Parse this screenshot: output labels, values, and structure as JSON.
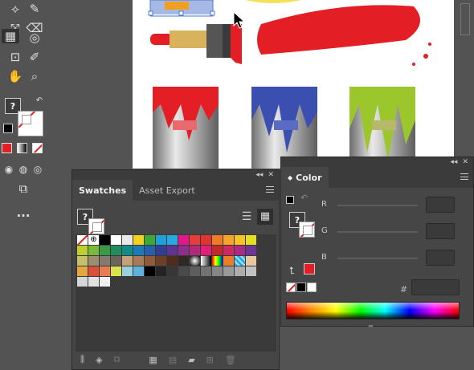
{
  "swatches_panel": {
    "tabs": [
      {
        "label": "Swatches"
      },
      {
        "label": "Asset Export"
      }
    ],
    "fill_glyph": "?",
    "swatch_colors": [
      "none",
      "registration",
      "#000000",
      "#ffffff",
      "#e8e8e8",
      "#f2d21a",
      "#3aa935",
      "#1ea1d8",
      "#27a9e1",
      "#e0198a",
      "#e83c3c",
      "#e0352e",
      "#f07a27",
      "#f4a52a",
      "#f6c224",
      "#e6de21",
      "#bdd12a",
      "#7ab93a",
      "#3a9b45",
      "#1f8d5d",
      "#108b88",
      "#1b7bb9",
      "#2560a8",
      "#303e93",
      "#5d3393",
      "#8d2e8d",
      "#b02a78",
      "#e31e78",
      "#c52a2a",
      "#cc2a62",
      "#ab2a85",
      "#6d3594",
      "#c7c06a",
      "#9c8f6f",
      "#837a70",
      "#6d6459",
      "#c4a178",
      "#a87b56",
      "#8d5a3a",
      "#6d3f25",
      "#4f2d1a",
      "#2f2a26",
      "gradient-radial",
      "gradient-bw",
      "gradient-rainbow",
      "#e87e2a",
      "pattern-blue",
      "#e9c8a0",
      "#e6a640",
      "#d9513c",
      "#e97c54",
      "#d9e34e",
      "#98d2df",
      "#5fb2dc",
      "#000000",
      "#232323",
      "#373737",
      "#4a4a4a",
      "#5e5e5e",
      "#727272",
      "#868686",
      "#9a9a9a",
      "#aeaeae",
      "#c2c2c2",
      "#d6d6d6",
      "#e2e2e2",
      "#f0f0f0"
    ],
    "bottom_icons": [
      "libraries-icon",
      "swatch-kinds-icon",
      "swatch-options-icon",
      "color-group-icon",
      "edit-group-icon",
      "new-group-folder-icon",
      "new-swatch-icon",
      "delete-icon"
    ]
  },
  "color_panel": {
    "tab_label": "Color",
    "fill_glyph": "?",
    "channels": [
      {
        "label": "R",
        "value": ""
      },
      {
        "label": "G",
        "value": ""
      },
      {
        "label": "B",
        "value": ""
      }
    ],
    "hex_symbol": "#",
    "hex_value": "",
    "current_color": "#e31e24"
  },
  "toolbar": {
    "fill_glyph": "?",
    "more_label": "..."
  }
}
